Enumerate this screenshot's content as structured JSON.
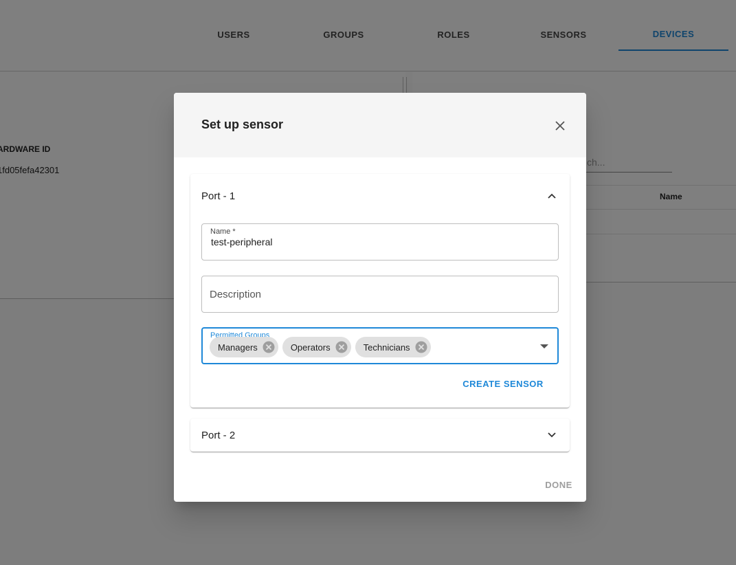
{
  "nav": {
    "tabs": [
      {
        "label": "USERS"
      },
      {
        "label": "GROUPS"
      },
      {
        "label": "ROLES"
      },
      {
        "label": "SENSORS"
      },
      {
        "label": "DEVICES"
      }
    ],
    "active_tab": "DEVICES"
  },
  "background": {
    "hardware_id_label": "ARDWARE ID",
    "hardware_id_value": "1fd05fefa42301",
    "search_placeholder": "ch...",
    "table_column": "Name"
  },
  "dialog": {
    "title": "Set up sensor",
    "close_icon": "close-icon",
    "ports": [
      {
        "title": "Port - 1",
        "expanded": true,
        "name_label": "Name *",
        "name_value": "test-peripheral",
        "description_placeholder": "Description",
        "groups_label": "Permitted Groups",
        "groups": [
          {
            "label": "Managers"
          },
          {
            "label": "Operators"
          },
          {
            "label": "Technicians"
          }
        ],
        "create_label": "CREATE SENSOR"
      },
      {
        "title": "Port - 2",
        "expanded": false
      }
    ],
    "done_label": "DONE"
  },
  "colors": {
    "accent": "#1e88d8",
    "overlay": "rgba(0,0,0,0.5)",
    "chip_bg": "#e0e0e0",
    "disabled_text": "#9e9e9e"
  }
}
